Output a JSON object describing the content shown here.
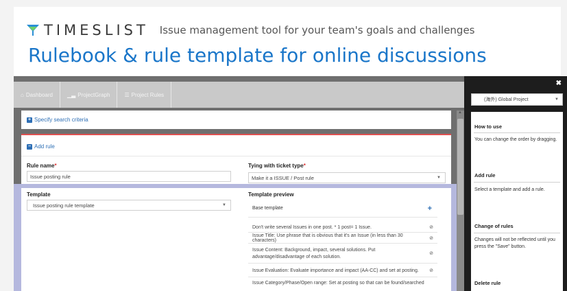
{
  "banner": {
    "brand_name": "TIMESLIST",
    "tagline": "Issue management tool for your team's goals and challenges",
    "headline": "Rulebook & rule template for online discussions",
    "brand_color": "#1a76c9"
  },
  "nav": {
    "items": [
      {
        "label": "Dashboard",
        "icon": "home-icon"
      },
      {
        "label": "ProjectGraph",
        "icon": "chart-icon"
      },
      {
        "label": "Project Rules",
        "icon": "list-icon"
      }
    ]
  },
  "search": {
    "label": "Specify search criteria"
  },
  "rule": {
    "add_rule_label": "Add rule",
    "name_label": "Rule name",
    "name_value": "Issue posting rule",
    "ticket_type_label": "Tying with ticket type",
    "ticket_type_value": "Make it a ISSUE / Post rule",
    "template_label": "Template",
    "template_value": "Issue posting rule template",
    "preview_label": "Template preview",
    "preview_header": "Base template",
    "preview_rows": [
      "Don't write several Issues in one post. * 1 post= 1 Issue.",
      "Issue Title: Use phrase that is obvious that it's an Issue (in less than 30 characters)",
      "Issue Content: Background, impact, several solutions. Put advantage/disadvantage of each solution.",
      "Issue Evaluation: Evaluate importance and impact (AA-CC) and set at posting.",
      "Issue Category/Phase/Open range: Set at posting so that can be found/searched"
    ]
  },
  "sidebar": {
    "project_select": "(海外) Global Project",
    "sections": [
      {
        "title": "How to use",
        "text": "You can change the order by dragging."
      },
      {
        "title": "Add rule",
        "text": "Select a template and add a rule."
      },
      {
        "title": "Change of rules",
        "text": "Changes will not be reflected until you press the \"Save\" button."
      },
      {
        "title": "Delete rule",
        "text": ""
      }
    ]
  }
}
